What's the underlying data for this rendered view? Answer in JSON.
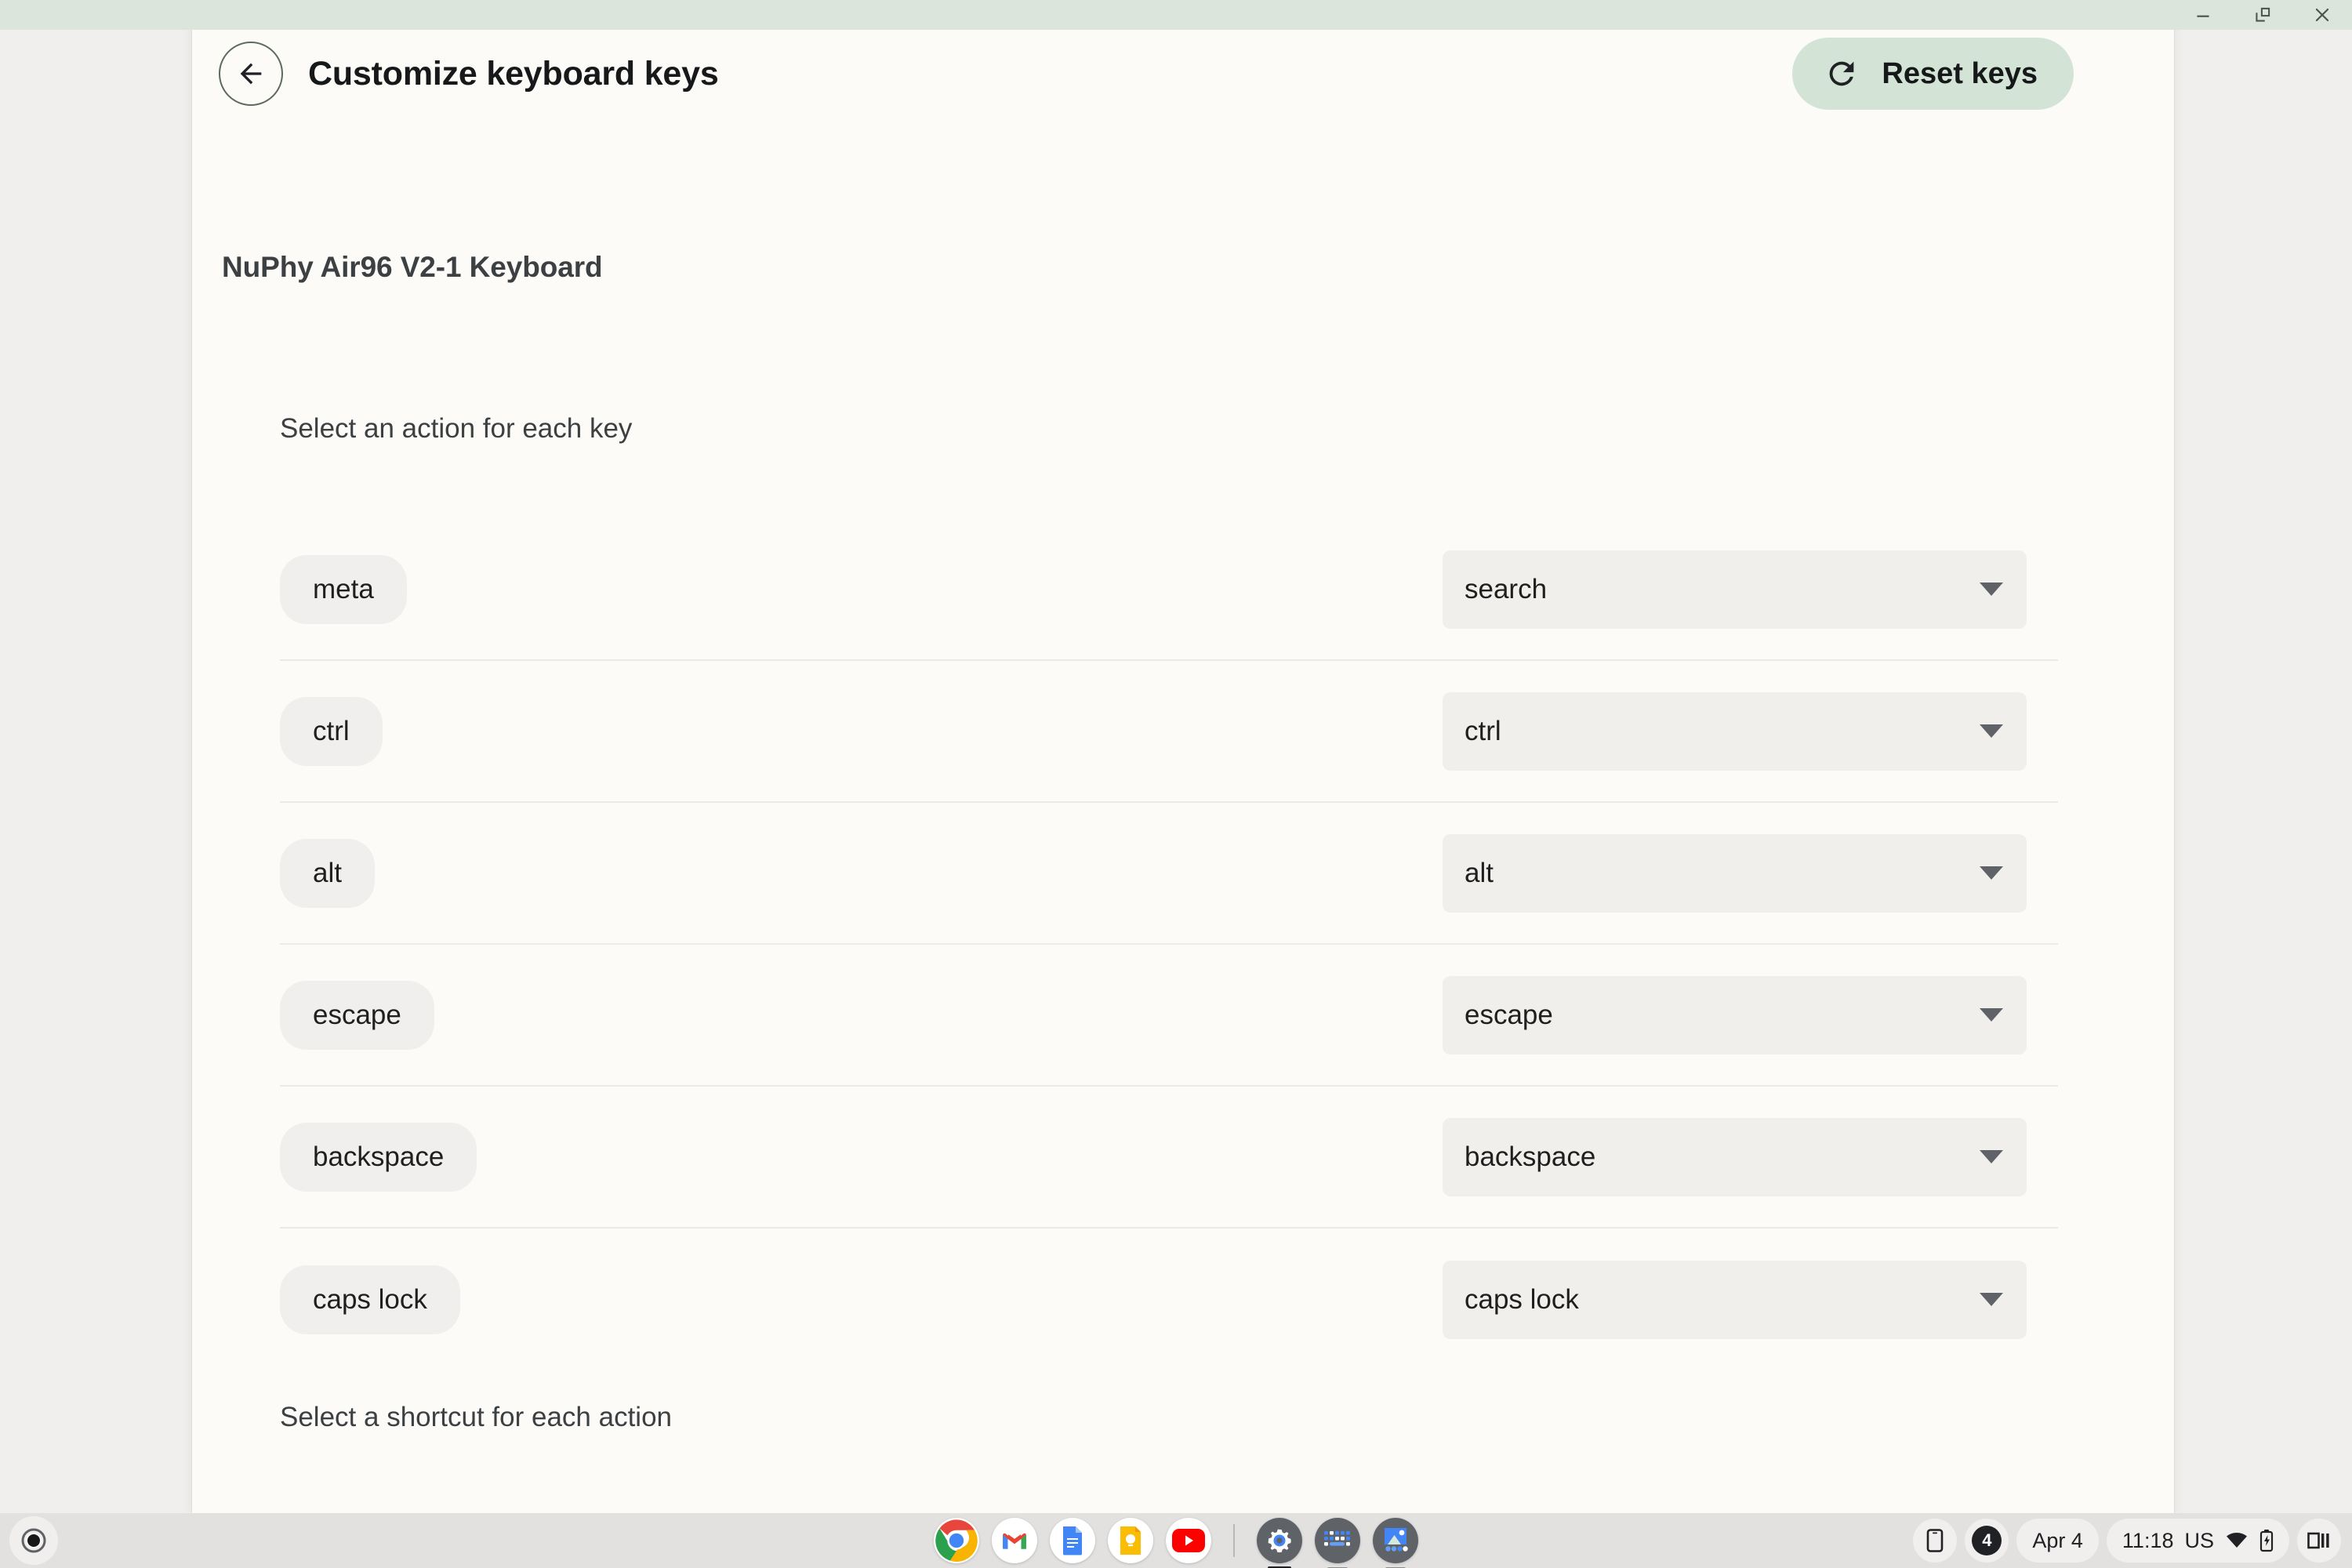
{
  "window": {
    "controls": [
      {
        "name": "minimize",
        "icon": "minimize-icon"
      },
      {
        "name": "restore",
        "icon": "restore-icon"
      },
      {
        "name": "close",
        "icon": "close-icon"
      }
    ]
  },
  "header": {
    "back_icon": "back-arrow-icon",
    "title": "Customize keyboard keys",
    "reset_button": {
      "label": "Reset keys",
      "icon": "refresh-icon",
      "background": "#d3e4d6"
    }
  },
  "body": {
    "device_name": "NuPhy Air96 V2-1 Keyboard",
    "section_heading": "Select an action for each key",
    "shortcut_heading": "Select a shortcut for each action",
    "key_rows": [
      {
        "key": "meta",
        "action": "search"
      },
      {
        "key": "ctrl",
        "action": "ctrl"
      },
      {
        "key": "alt",
        "action": "alt"
      },
      {
        "key": "escape",
        "action": "escape"
      },
      {
        "key": "backspace",
        "action": "backspace"
      },
      {
        "key": "caps lock",
        "action": "caps lock"
      }
    ]
  },
  "shelf": {
    "launcher_icon": "launcher-icon",
    "apps": [
      {
        "name": "chrome",
        "icon": "chrome-icon",
        "running": false
      },
      {
        "name": "gmail",
        "icon": "gmail-icon",
        "running": false
      },
      {
        "name": "docs",
        "icon": "docs-icon",
        "running": false
      },
      {
        "name": "keep",
        "icon": "keep-icon",
        "running": false
      },
      {
        "name": "youtube",
        "icon": "youtube-icon",
        "running": false
      },
      {
        "name": "settings",
        "icon": "settings-gear-icon",
        "running": true,
        "active": true
      },
      {
        "name": "keyboard",
        "icon": "keyboard-icon",
        "running": true
      },
      {
        "name": "gallery",
        "icon": "gallery-icon",
        "running": true
      }
    ],
    "status": {
      "phone_hub_icon": "phone-icon",
      "desk_count": "4",
      "date": "Apr 4",
      "time": "11:18",
      "locale": "US",
      "wifi_icon": "wifi-icon",
      "battery_icon": "battery-charging-icon",
      "layout_icon": "window-layout-icon"
    }
  }
}
